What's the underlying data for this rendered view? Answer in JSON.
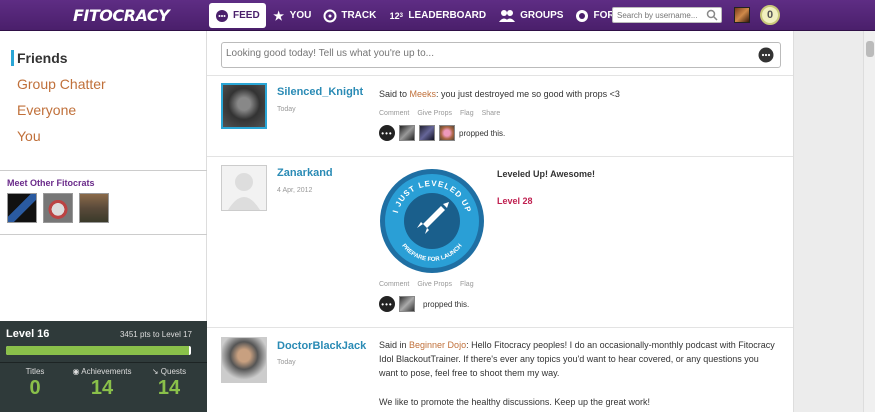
{
  "app": {
    "logo": "FITOCRACY"
  },
  "nav": [
    {
      "label": "FEED",
      "icon": "chat-bubble-icon"
    },
    {
      "label": "YOU",
      "icon": "star-icon"
    },
    {
      "label": "TRACK",
      "icon": "gauge-icon"
    },
    {
      "label": "LEADERBOARD",
      "icon": "123-icon"
    },
    {
      "label": "GROUPS",
      "icon": "people-icon"
    },
    {
      "label": "FORUM",
      "icon": "forum-icon"
    }
  ],
  "search": {
    "placeholder": "Search by username..."
  },
  "user": {
    "coin_count": "0"
  },
  "sidebar": {
    "items": [
      {
        "label": "Friends"
      },
      {
        "label": "Group Chatter"
      },
      {
        "label": "Everyone"
      },
      {
        "label": "You"
      }
    ],
    "meet_title": "Meet Other Fitocrats"
  },
  "level": {
    "label": "Level 16",
    "pts_text": "3451 pts to Level 17",
    "progress": 0.99,
    "titles_label": "Titles",
    "titles_value": "0",
    "achievements_label": "Achievements",
    "achievements_value": "14",
    "quests_label": "Quests",
    "quests_value": "14"
  },
  "status": {
    "placeholder": "Looking good today! Tell us what you're up to..."
  },
  "feed": [
    {
      "name": "Silenced_Knight",
      "date": "Today",
      "said_prefix": "Said to ",
      "target": "Meeks",
      "message": ": you just destroyed me so good with props <3",
      "actions": [
        "Comment",
        "Give Props",
        "Flag",
        "Share"
      ],
      "props_text": "propped this."
    },
    {
      "name": "Zanarkand",
      "date": "4 Apr, 2012",
      "badge_top": "I JUST LEVELED UP",
      "badge_bottom": "PREPARE FOR LAUNCH",
      "title": "Leveled Up! Awesome!",
      "level": "Level 28",
      "actions": [
        "Comment",
        "Give Props",
        "Flag"
      ],
      "props_text": "propped this."
    },
    {
      "name": "DoctorBlackJack",
      "date": "Today",
      "said_prefix": "Said in ",
      "target": "Beginner Dojo",
      "message": ": Hello Fitocracy peoples! I do an occasionally-monthly podcast with Fitocracy Idol BlackoutTrainer. If there's ever any topics you'd want to hear covered, or any questions you want to pose, feel free to shoot them my way.",
      "message2": "We like to promote the healthy discussions. Keep up the great work!"
    }
  ]
}
